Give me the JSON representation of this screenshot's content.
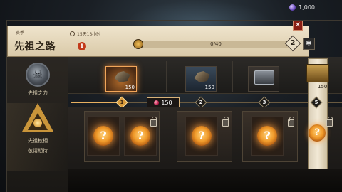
{
  "currency": {
    "icon": "gem-icon",
    "amount": "1,000"
  },
  "header": {
    "season_label": "赛季",
    "timer": "15天13小时",
    "title": "先祖之路",
    "progress_text": "0/40",
    "progress_fraction": 0,
    "level": "2",
    "close_label": "✕",
    "settings_label": "✱"
  },
  "sidebar": {
    "items": [
      {
        "label": "先祖之力",
        "icon": "skull-emblem-icon"
      },
      {
        "label": "先祖权柄",
        "sub": "敬请期待",
        "icon": "triangle-emblem-icon"
      }
    ]
  },
  "rewards": [
    {
      "qty": "150",
      "kind": "item",
      "state": "active"
    },
    {
      "qty": "150",
      "kind": "item",
      "state": "normal"
    },
    {
      "qty": "",
      "kind": "chest",
      "state": "normal"
    },
    {
      "qty": "150",
      "kind": "chest-gold",
      "state": "normal"
    }
  ],
  "track": {
    "nodes": [
      "1",
      "2",
      "3",
      "5"
    ],
    "cost": "150"
  },
  "mystery": {
    "symbol": "?"
  },
  "colors": {
    "accent": "#f09a2a",
    "close": "#8a1e14",
    "parchment": "#efe4cc"
  }
}
